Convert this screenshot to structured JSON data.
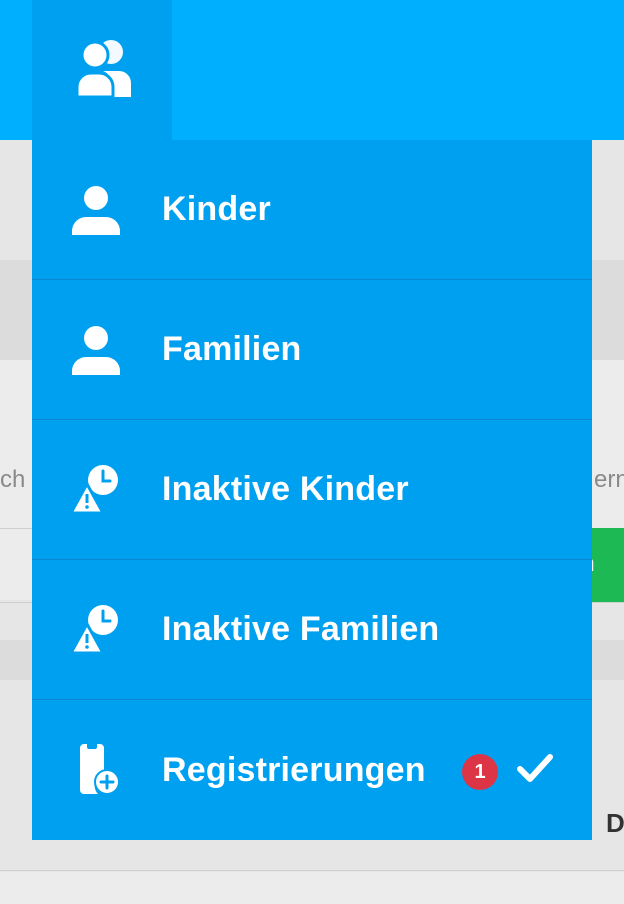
{
  "colors": {
    "topbar": "#00b0ff",
    "menu": "#00a0f0",
    "badge": "#dc3545",
    "success": "#1db954"
  },
  "topbar": {
    "icon": "users-icon"
  },
  "menu": {
    "items": [
      {
        "label": "Kinder",
        "icon": "user-icon"
      },
      {
        "label": "Familien",
        "icon": "user-icon"
      },
      {
        "label": "Inaktive Kinder",
        "icon": "user-clock-warning-icon"
      },
      {
        "label": "Inaktive Familien",
        "icon": "user-clock-warning-icon"
      },
      {
        "label": "Registrierungen",
        "icon": "file-plus-icon",
        "badge": "1",
        "active": true
      }
    ]
  },
  "background": {
    "left_fragment": "ch s",
    "right_fragment": "ern-",
    "button_fragment": "n",
    "bold_fragment": "D"
  }
}
